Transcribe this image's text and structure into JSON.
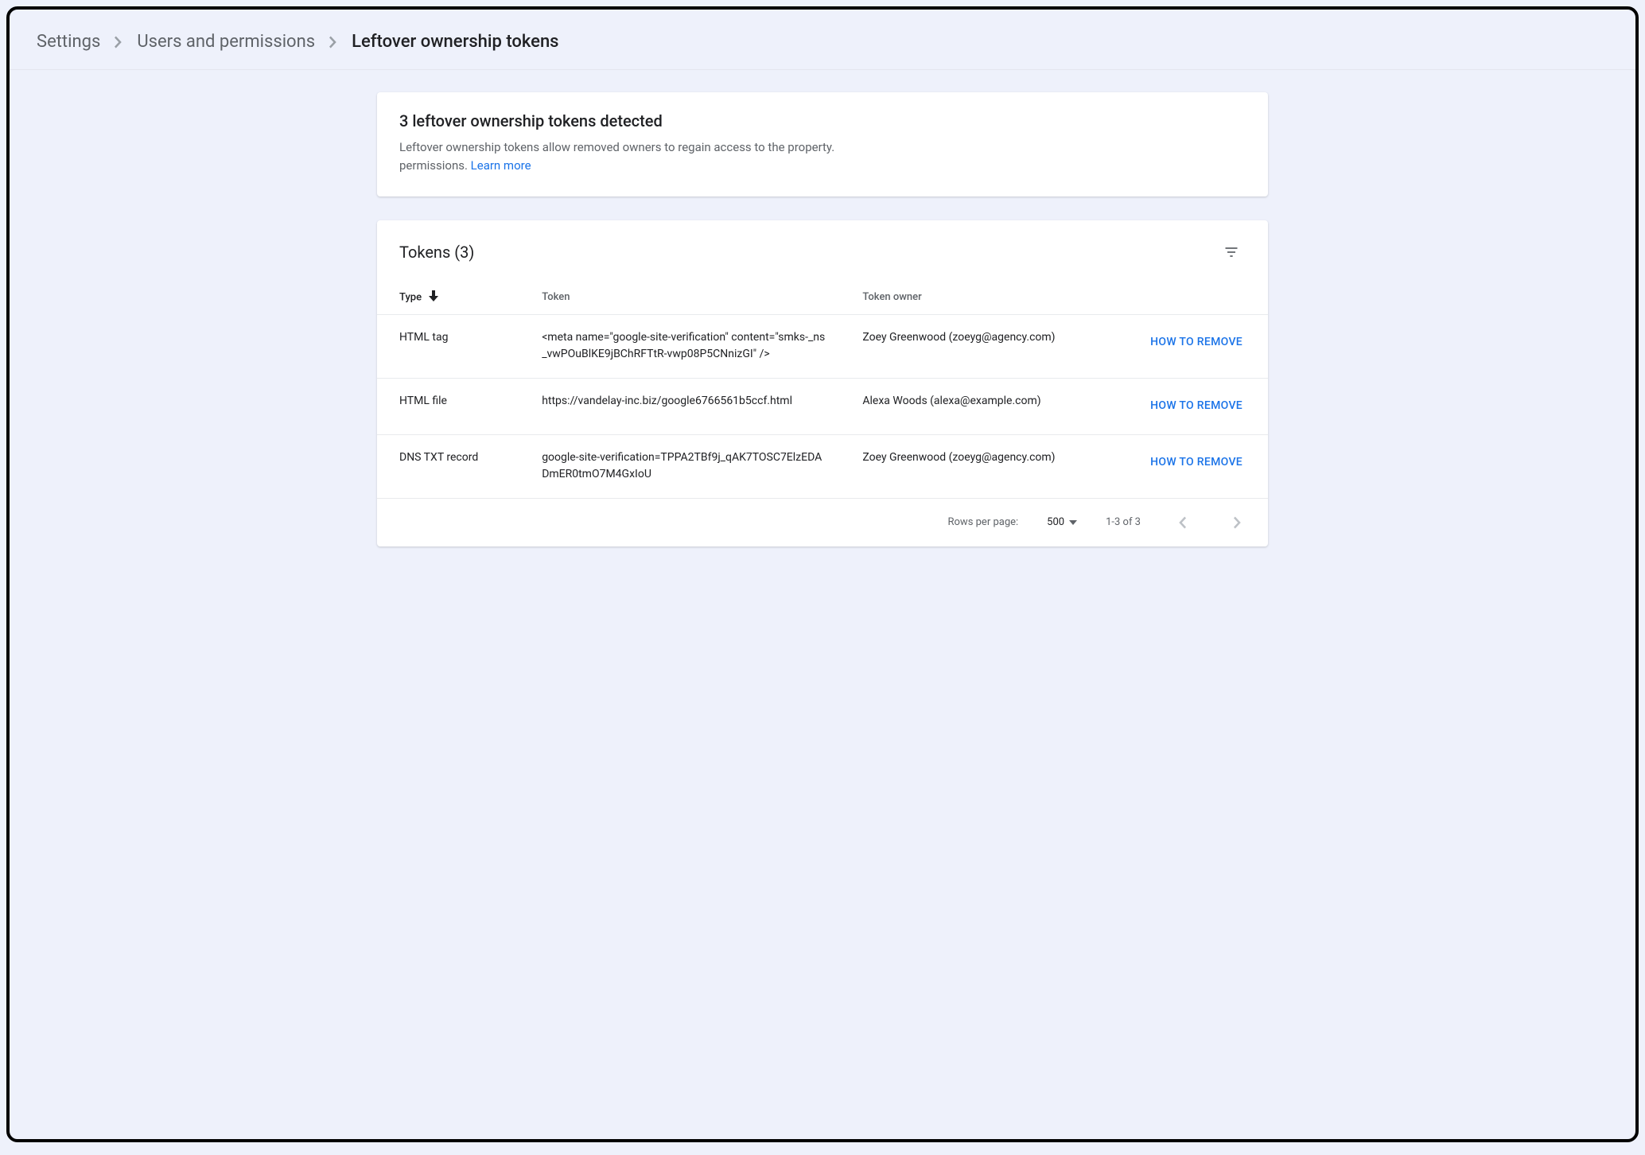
{
  "breadcrumb": {
    "items": [
      "Settings",
      "Users and permissions",
      "Leftover ownership tokens"
    ]
  },
  "banner": {
    "title": "3 leftover ownership tokens detected",
    "body_line1": "Leftover ownership tokens allow removed owners to regain access to the property.",
    "body_line2_prefix": "permissions. ",
    "learn_more": "Learn more"
  },
  "table": {
    "title": "Tokens (3)",
    "columns": {
      "type": "Type",
      "token": "Token",
      "owner": "Token owner"
    },
    "action_label": "HOW TO REMOVE",
    "rows": [
      {
        "type": "HTML tag",
        "token": "<meta name=\"google-site-verification\" content=\"smks-_ns_vwPOuBlKE9jBChRFTtR-vwp08P5CNnizGI\" />",
        "owner": "Zoey Greenwood (zoeyg@agency.com)"
      },
      {
        "type": "HTML file",
        "token": "https://vandelay-inc.biz/google6766561b5ccf.html",
        "owner": "Alexa Woods (alexa@example.com)"
      },
      {
        "type": "DNS TXT record",
        "token": "google-site-verification=TPPA2TBf9j_qAK7TOSC7ElzEDADmER0tmO7M4GxIoU",
        "owner": "Zoey Greenwood (zoeyg@agency.com)"
      }
    ]
  },
  "pagination": {
    "rows_per_page_label": "Rows per page:",
    "rows_per_page_value": "500",
    "range": "1-3 of 3"
  }
}
